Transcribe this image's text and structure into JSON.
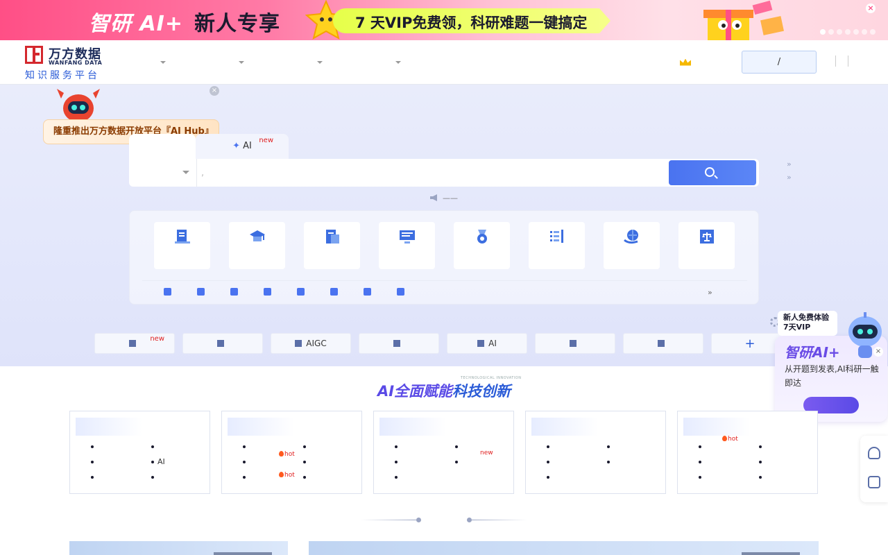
{
  "banner": {
    "brand": "智研 AI+",
    "offer": "新人专享",
    "pill": "7 天VIP免费领，科研难题一键搞定",
    "close": "×"
  },
  "header": {
    "logo_cn": "万方数据",
    "logo_en": "WANFANG DATA",
    "slogan": "知识服务平台",
    "nav": [
      "",
      "",
      "",
      ""
    ],
    "vip": "",
    "login": "/ "
  },
  "announce": {
    "text": "隆重推出万方数据开放平台『AI Hub』",
    "close": "×"
  },
  "hero": {
    "title": "",
    "tabs": [
      "",
      "AI"
    ],
    "new_tag": "new",
    "search_scope": "",
    "search_placeholder": ", ",
    "search_button": "",
    "side_links": [
      "",
      ""
    ],
    "side_arrow": "»",
    "notice": "——"
  },
  "resources": {
    "cards": [
      {
        "label": "",
        "icon": "journal-icon"
      },
      {
        "label": "",
        "icon": "graduation-cap-icon"
      },
      {
        "label": "",
        "icon": "conference-icon"
      },
      {
        "label": "",
        "icon": "monitor-icon"
      },
      {
        "label": "",
        "icon": "award-medal-icon"
      },
      {
        "label": "",
        "icon": "checklist-icon"
      },
      {
        "label": "",
        "icon": "globe-hand-icon"
      },
      {
        "label": "",
        "icon": "law-scale-icon"
      }
    ],
    "sub": [
      "",
      "",
      "",
      "",
      "",
      "",
      "",
      "",
      ""
    ],
    "more": "»"
  },
  "quick": {
    "label": "",
    "items": [
      {
        "label": "",
        "new": "new"
      },
      {
        "label": "",
        "new": ""
      },
      {
        "label": "AIGC",
        "new": ""
      },
      {
        "label": "",
        "new": ""
      },
      {
        "label": "AI",
        "new": ""
      },
      {
        "label": "",
        "new": ""
      },
      {
        "label": "",
        "new": ""
      },
      {
        "label": "",
        "new": ""
      }
    ]
  },
  "ai_float": {
    "bubble": "新人免费体验 7天VIP",
    "title": "智研AI+",
    "desc": "从开题到发表,AI科研一触即达",
    "button": "",
    "close": "×"
  },
  "ai_section": {
    "title_a": "AI全面赋能",
    "title_b": "科技创新",
    "subtitle": "TECHNOLOGICAL INNOVATION",
    "cards": [
      {
        "title": "",
        "items": [
          {
            "t": ""
          },
          {
            "t": ""
          },
          {
            "t": ""
          },
          {
            "t": "AI"
          },
          {
            "t": ""
          },
          {
            "t": ""
          }
        ]
      },
      {
        "title": "",
        "items": [
          {
            "t": ""
          },
          {
            "t": ""
          },
          {
            "t": "",
            "tag": "hot"
          },
          {
            "t": ""
          },
          {
            "t": "",
            "tag": "hot"
          },
          {
            "t": ""
          }
        ]
      },
      {
        "title": "",
        "items": [
          {
            "t": ""
          },
          {
            "t": ""
          },
          {
            "t": ""
          },
          {
            "t": "",
            "tag": "new"
          },
          {
            "t": "",
            "wide": true
          }
        ]
      },
      {
        "title": "",
        "items": [
          {
            "t": ""
          },
          {
            "t": ""
          },
          {
            "t": ""
          },
          {
            "t": ""
          },
          {
            "t": ""
          }
        ]
      },
      {
        "title": "",
        "items": [
          {
            "t": "",
            "tag": "hot"
          },
          {
            "t": ""
          },
          {
            "t": ""
          },
          {
            "t": ""
          },
          {
            "t": ""
          },
          {
            "t": ""
          }
        ]
      }
    ]
  },
  "news": {
    "title": ""
  }
}
